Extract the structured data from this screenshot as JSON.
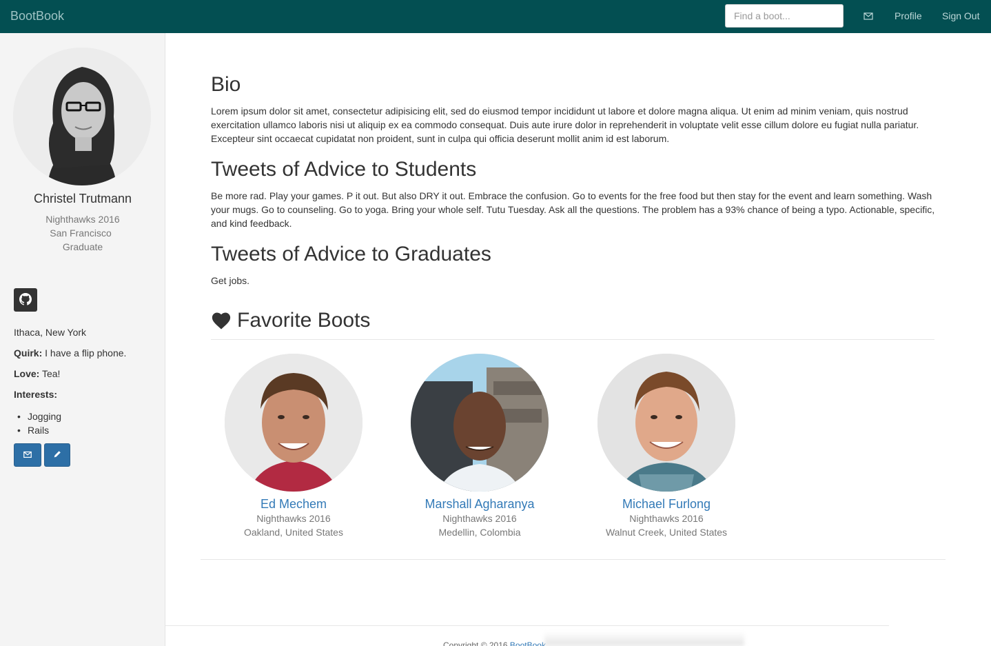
{
  "navbar": {
    "brand": "BootBook",
    "search_placeholder": "Find a boot...",
    "mail_icon": "envelope-icon",
    "profile": "Profile",
    "sign_out": "Sign Out",
    "background": "#034f52"
  },
  "sidebar": {
    "name": "Christel Trutmann",
    "cohort": "Nighthawks 2016",
    "city": "San Francisco",
    "status": "Graduate",
    "github_icon": "github-icon",
    "hometown": "Ithaca, New York",
    "quirk_label": "Quirk:",
    "quirk": "I have a flip phone.",
    "love_label": "Love:",
    "love": "Tea!",
    "interests_label": "Interests:",
    "interests": [
      "Jogging",
      "Rails"
    ],
    "buttons": [
      {
        "icon": "envelope-icon"
      },
      {
        "icon": "pencil-icon"
      }
    ]
  },
  "main": {
    "bio_title": "Bio",
    "bio_text": "Lorem ipsum dolor sit amet, consectetur adipisicing elit, sed do eiusmod tempor incididunt ut labore et dolore magna aliqua. Ut enim ad minim veniam, quis nostrud exercitation ullamco laboris nisi ut aliquip ex ea commodo consequat. Duis aute irure dolor in reprehenderit in voluptate velit esse cillum dolore eu fugiat nulla pariatur. Excepteur sint occaecat cupidatat non proident, sunt in culpa qui officia deserunt mollit anim id est laborum.",
    "students_title": "Tweets of Advice to Students",
    "students_text": "Be more rad. Play your games. P it out. But also DRY it out. Embrace the confusion. Go to events for the free food but then stay for the event and learn something. Wash your mugs. Go to counseling. Go to yoga. Bring your whole self. Tutu Tuesday. Ask all the questions. The problem has a 93% chance of being a typo. Actionable, specific, and kind feedback.",
    "graduates_title": "Tweets of Advice to Graduates",
    "graduates_text": "Get jobs.",
    "favorites_title": "Favorite Boots",
    "favorites_icon": "heart-icon",
    "favorites": [
      {
        "name": "Ed Mechem",
        "cohort": "Nighthawks 2016",
        "location": "Oakland, United States"
      },
      {
        "name": "Marshall Agharanya",
        "cohort": "Nighthawks 2016",
        "location": "Medellin, Colombia"
      },
      {
        "name": "Michael Furlong",
        "cohort": "Nighthawks 2016",
        "location": "Walnut Creek, United States"
      }
    ]
  },
  "footer": {
    "text": "Copyright © 2016",
    "link": "BootBook"
  }
}
